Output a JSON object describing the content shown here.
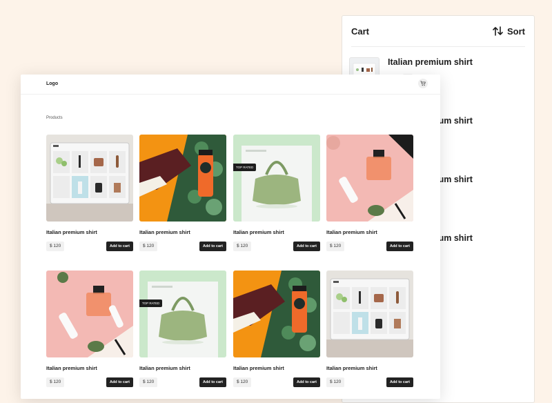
{
  "cart_panel": {
    "title": "Cart",
    "sort_label": "Sort",
    "items": [
      "Italian premium shirt",
      "Italian premium shirt",
      "Italian premium shirt",
      "Italian premium shirt"
    ]
  },
  "header": {
    "logo": "Logo"
  },
  "section_title": "Products",
  "products": [
    {
      "name": "Italian premium shirt",
      "price": "$ 120",
      "button": "Add to cart",
      "image": "tablet-shop-photo"
    },
    {
      "name": "Italian premium shirt",
      "price": "$ 120",
      "button": "Add to cart",
      "image": "sneaker-juice-photo"
    },
    {
      "name": "Italian premium shirt",
      "price": "$ 120",
      "button": "Add to cart",
      "image": "green-bag-photo",
      "badge": "TOP RATED"
    },
    {
      "name": "Italian premium shirt",
      "price": "$ 120",
      "button": "Add to cart",
      "image": "perfume-cosmetics-photo"
    },
    {
      "name": "Italian premium shirt",
      "price": "$ 120",
      "button": "Add to cart",
      "image": "perfume-cosmetics-photo"
    },
    {
      "name": "Italian premium shirt",
      "price": "$ 120",
      "button": "Add to cart",
      "image": "green-bag-photo",
      "badge": "TOP RATED"
    },
    {
      "name": "Italian premium shirt",
      "price": "$ 120",
      "button": "Add to cart",
      "image": "sneaker-juice-photo"
    },
    {
      "name": "Italian premium shirt",
      "price": "$ 120",
      "button": "Add to cart",
      "image": "tablet-shop-photo"
    }
  ],
  "icons": {
    "sort": "sort-arrows-icon",
    "cart": "shopping-cart-icon"
  },
  "colors": {
    "background": "#fdf3e9",
    "button": "#222222",
    "price_chip": "#f1f1f1"
  }
}
